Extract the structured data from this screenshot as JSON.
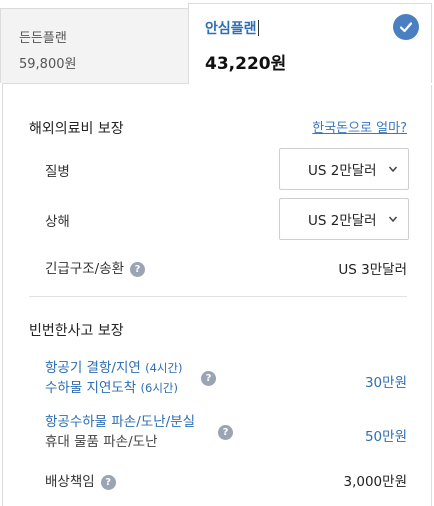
{
  "tabs": [
    {
      "name": "든든플랜",
      "price": "59,800원",
      "selected": false
    },
    {
      "name": "안심플랜",
      "price": "43,220원",
      "selected": true
    }
  ],
  "overseas_medical": {
    "title": "해외의료비 보장",
    "link": "한국돈으로 얼마?",
    "rows": [
      {
        "label": "질병",
        "value": "US 2만달러"
      },
      {
        "label": "상해",
        "value": "US 2만달러"
      },
      {
        "label": "긴급구조/송환",
        "value": "US 3만달러"
      }
    ]
  },
  "frequent_accidents": {
    "title": "빈번한사고 보장",
    "rows": [
      {
        "line1": "항공기 결항/지연",
        "line1_note": "(4시간)",
        "line2": "수하물 지연도착",
        "line2_note": "(6시간)",
        "value": "30만원"
      },
      {
        "line1": "항공수하물 파손/도난/분실",
        "line2": "휴대 물품 파손/도난",
        "value": "50만원"
      },
      {
        "label": "배상책임",
        "value": "3,000만원"
      }
    ]
  },
  "icons": {
    "check": "check-icon",
    "help": "question-icon",
    "chevron": "chevron-down-icon"
  },
  "colors": {
    "accent": "#4a7fc1",
    "link": "#3a78c0",
    "blue_text": "#2f6fb3"
  }
}
